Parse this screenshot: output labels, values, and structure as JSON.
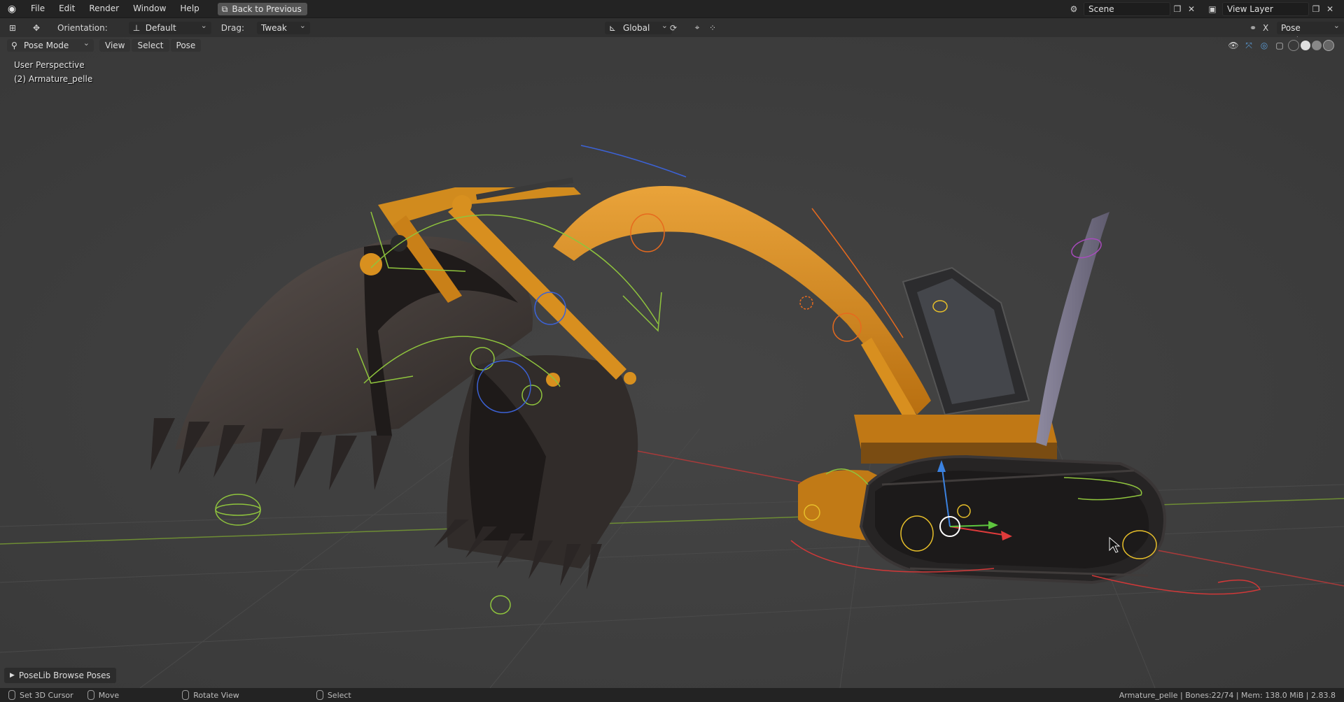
{
  "topbar": {
    "menus": [
      "File",
      "Edit",
      "Render",
      "Window",
      "Help"
    ],
    "back_label": "Back to Previous",
    "scene_name": "Scene",
    "view_layer": "View Layer"
  },
  "header": {
    "orientation_label": "Orientation:",
    "orientation_value": "Default",
    "drag_label": "Drag:",
    "drag_value": "Tweak",
    "transform_space": "Global",
    "pose_options": "Pose Options"
  },
  "view_header": {
    "mode": "Pose Mode",
    "menus": [
      "View",
      "Select",
      "Pose"
    ]
  },
  "viewport": {
    "perspective": "User Perspective",
    "object": "(2) Armature_pelle"
  },
  "poselib": {
    "label": "PoseLib Browse Poses"
  },
  "status": {
    "items": [
      "Set 3D Cursor",
      "Move",
      "Rotate View",
      "Select"
    ],
    "info": "Armature_pelle | Bones:22/74 | Mem: 138.0 MiB | 2.83.8"
  },
  "colors": {
    "bucket": "#3a3432",
    "arm": "#d88f1f",
    "track": "#262424",
    "grid_x": "#a83a3a",
    "grid_y": "#6e8d34"
  }
}
